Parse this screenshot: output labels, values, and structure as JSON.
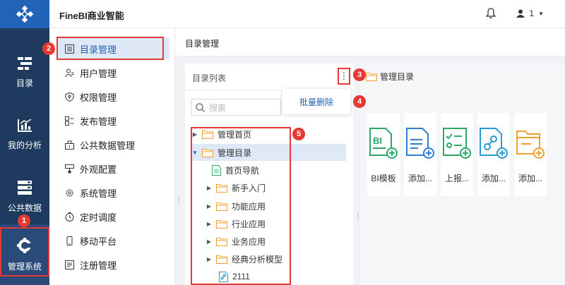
{
  "header": {
    "app_title": "FineBI商业智能",
    "user_label": "1",
    "bell_icon": "bell-icon",
    "user_icon": "user-icon"
  },
  "rail": {
    "logo_icon": "finebi-logo-icon",
    "items": [
      {
        "label": "目录",
        "icon": "catalog-icon"
      },
      {
        "label": "我的分析",
        "icon": "analysis-chart-icon"
      },
      {
        "label": "公共数据",
        "icon": "database-icon"
      },
      {
        "label": "管理系统",
        "icon": "gear-icon"
      }
    ]
  },
  "menu": {
    "items": [
      {
        "label": "目录管理",
        "icon": "list-icon"
      },
      {
        "label": "用户管理",
        "icon": "user-manage-icon"
      },
      {
        "label": "权限管理",
        "icon": "shield-icon"
      },
      {
        "label": "发布管理",
        "icon": "publish-icon"
      },
      {
        "label": "公共数据管理",
        "icon": "public-data-icon"
      },
      {
        "label": "外观配置",
        "icon": "appearance-icon"
      },
      {
        "label": "系统管理",
        "icon": "settings-icon"
      },
      {
        "label": "定时调度",
        "icon": "timer-icon"
      },
      {
        "label": "移动平台",
        "icon": "mobile-icon"
      },
      {
        "label": "注册管理",
        "icon": "register-icon"
      }
    ]
  },
  "content": {
    "title": "目录管理",
    "panel_title": "目录列表",
    "more_label": "⋮",
    "search_placeholder": "搜索",
    "popup_action": "批量删除",
    "tree": [
      {
        "label": "管理首页",
        "type": "folder",
        "expand": "collapsed",
        "level": 0
      },
      {
        "label": "管理目录",
        "type": "folder",
        "expand": "expanded",
        "level": 0
      },
      {
        "label": "首页导航",
        "type": "file",
        "expand": "none",
        "level": 1
      },
      {
        "label": "新手入门",
        "type": "folder",
        "expand": "collapsed",
        "level": 1
      },
      {
        "label": "功能应用",
        "type": "folder",
        "expand": "collapsed",
        "level": 1
      },
      {
        "label": "行业应用",
        "type": "folder",
        "expand": "collapsed",
        "level": 1
      },
      {
        "label": "业务应用",
        "type": "folder",
        "expand": "collapsed",
        "level": 1
      },
      {
        "label": "经典分析模型",
        "type": "folder",
        "expand": "collapsed",
        "level": 1
      },
      {
        "label": "2111",
        "type": "link",
        "expand": "none",
        "level": 1
      }
    ],
    "right_title": "管理目录",
    "cards": [
      {
        "label": "BI模板",
        "icon": "bi-template-add-icon",
        "color": "#2aa866"
      },
      {
        "label": "添加...",
        "icon": "add-doc-icon",
        "color": "#2a7fd4"
      },
      {
        "label": "上报...",
        "icon": "report-add-icon",
        "color": "#2aa866"
      },
      {
        "label": "添加...",
        "icon": "add-link-icon",
        "color": "#2a9ad4"
      },
      {
        "label": "添加...",
        "icon": "add-folder-icon",
        "color": "#f0a030"
      }
    ]
  },
  "annotations": [
    "1",
    "2",
    "3",
    "4",
    "5"
  ],
  "colors": {
    "rail": "#1e3a5f",
    "accent": "#2263b8",
    "highlight": "#dfe8f7",
    "annotation": "#e53935",
    "folder": "#f0a030"
  }
}
